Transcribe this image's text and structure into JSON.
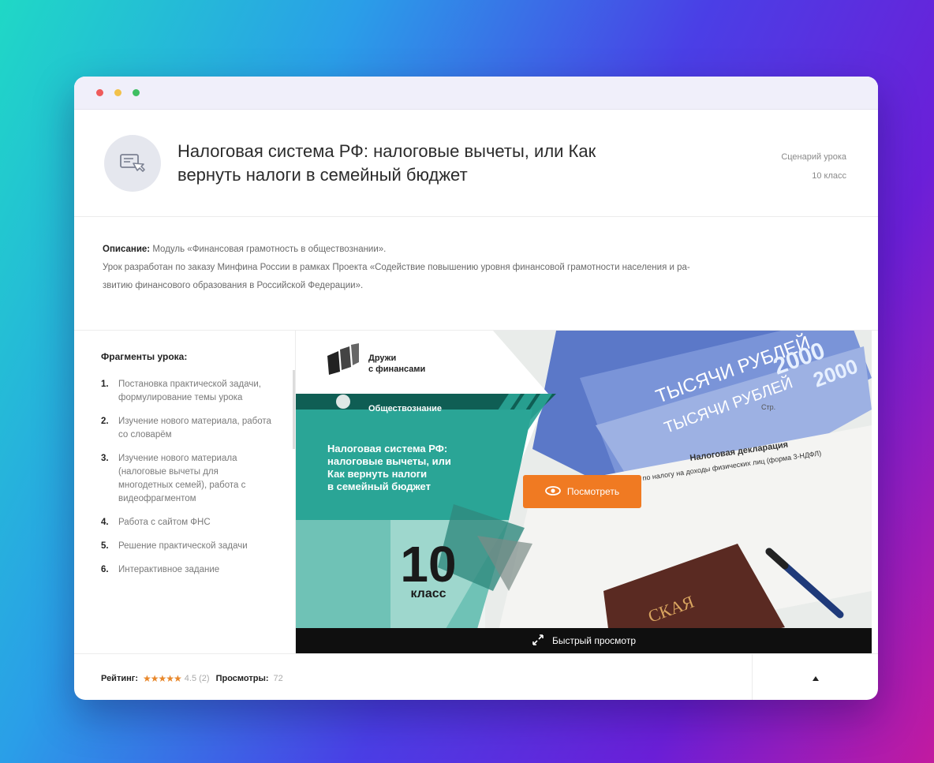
{
  "colors": {
    "accent": "#f07a22",
    "teal_dark": "#0f5e54",
    "teal": "#2aa596",
    "dot_red": "#ef5b5b",
    "dot_yellow": "#f2c14a",
    "dot_green": "#3fbf62"
  },
  "header": {
    "title": "Налоговая система РФ: налоговые вычеты, или Как вернуть налоги в семейный бюджет",
    "type": "Сценарий урока",
    "grade": "10 класс",
    "icon": "lesson-card-icon"
  },
  "description": {
    "label": "Описание:",
    "line1": "Модуль «Финансовая грамотность в обществознании».",
    "line2": "Урок разработан по заказу Минфина России в рамках Проекта «Содействие повышению уровня финансовой грамотности населения и ра-",
    "line3": "звитию финансового образования в Российской Федерации»."
  },
  "fragments": {
    "title": "Фрагменты урока:",
    "items": [
      {
        "num": "1.",
        "text": "Постановка практической задачи, формулирование темы урока"
      },
      {
        "num": "2.",
        "text": "Изучение нового материала, работа со словарём"
      },
      {
        "num": "3.",
        "text": "Изучение нового материала (налоговые вычеты для многодетных семей), работа с видеофрагментом"
      },
      {
        "num": "4.",
        "text": "Работа с сайтом ФНС"
      },
      {
        "num": "5.",
        "text": "Решение практической задачи"
      },
      {
        "num": "6.",
        "text": "Интерактивное задание"
      }
    ]
  },
  "preview": {
    "brand_line1": "Дружи",
    "brand_line2": "с финансами",
    "subject": "Обществознание",
    "title_line1": "Налоговая система РФ:",
    "title_line2": "налоговые вычеты, или",
    "title_line3": "Как вернуть налоги",
    "title_line4": "в семейный бюджет",
    "grade_number": "10",
    "grade_word": "класс",
    "banknote_value": "2000",
    "banknote_text": "ТЫСЯЧИ РУБЛЕЙ",
    "form_title": "Налоговая декларация",
    "form_subtitle": "по налогу на доходы физических лиц (форма 3-НДФЛ)",
    "form_page": "Стр.",
    "passport_text": "СКАЯ",
    "watch_label": "Посмотреть",
    "quick_view_label": "Быстрый просмотр"
  },
  "footer": {
    "rating_label": "Рейтинг:",
    "stars": "★★★★★",
    "rating_value": "4.5 (2)",
    "views_label": "Просмотры:",
    "views_value": "72"
  }
}
